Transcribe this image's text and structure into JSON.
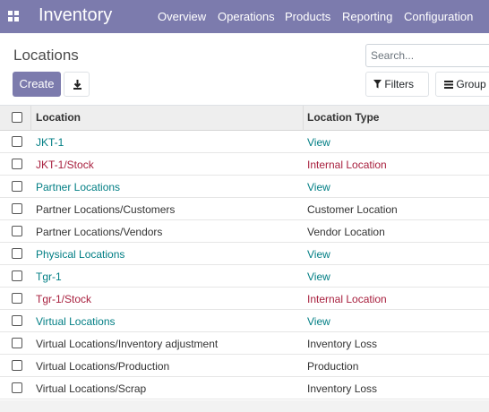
{
  "app": {
    "title": "Inventory"
  },
  "nav": {
    "items": [
      "Overview",
      "Operations",
      "Products",
      "Reporting",
      "Configuration"
    ]
  },
  "control_panel": {
    "breadcrumb": "Locations",
    "create_label": "Create",
    "search_placeholder": "Search...",
    "filters_label": "Filters",
    "group_by_label": "Group By"
  },
  "table": {
    "columns": [
      "Location",
      "Location Type"
    ],
    "rows": [
      {
        "location": "JKT-1",
        "type": "View",
        "style": "link"
      },
      {
        "location": "JKT-1/Stock",
        "type": "Internal Location",
        "style": "internal"
      },
      {
        "location": "Partner Locations",
        "type": "View",
        "style": "link"
      },
      {
        "location": "Partner Locations/Customers",
        "type": "Customer Location",
        "style": "plain"
      },
      {
        "location": "Partner Locations/Vendors",
        "type": "Vendor Location",
        "style": "plain"
      },
      {
        "location": "Physical Locations",
        "type": "View",
        "style": "link"
      },
      {
        "location": "Tgr-1",
        "type": "View",
        "style": "link"
      },
      {
        "location": "Tgr-1/Stock",
        "type": "Internal Location",
        "style": "internal"
      },
      {
        "location": "Virtual Locations",
        "type": "View",
        "style": "link"
      },
      {
        "location": "Virtual Locations/Inventory adjustment",
        "type": "Inventory Loss",
        "style": "plain"
      },
      {
        "location": "Virtual Locations/Production",
        "type": "Production",
        "style": "plain"
      },
      {
        "location": "Virtual Locations/Scrap",
        "type": "Inventory Loss",
        "style": "plain"
      }
    ]
  },
  "colors": {
    "brand": "#7c7bad",
    "link": "#017e84",
    "internal": "#a8203e"
  }
}
